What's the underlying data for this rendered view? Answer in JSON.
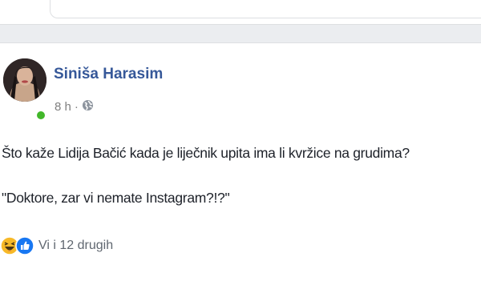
{
  "post": {
    "author": "Siniša Harasim",
    "time": "8 h",
    "separator": "·",
    "audience_icon": "globe-icon",
    "text_line1": "Što kaže Lidija Bačić kada je liječnik upita ima li kvržice na grudima?",
    "text_line2": "\"Doktore, zar vi nemate Instagram?!?\"",
    "reactions": {
      "icons": [
        "haha-icon",
        "like-icon"
      ],
      "summary": "Vi i 12 drugih"
    }
  },
  "colors": {
    "author": "#365899",
    "online": "#42b72a",
    "like": "#1877f2",
    "haha": "#f7b928"
  }
}
